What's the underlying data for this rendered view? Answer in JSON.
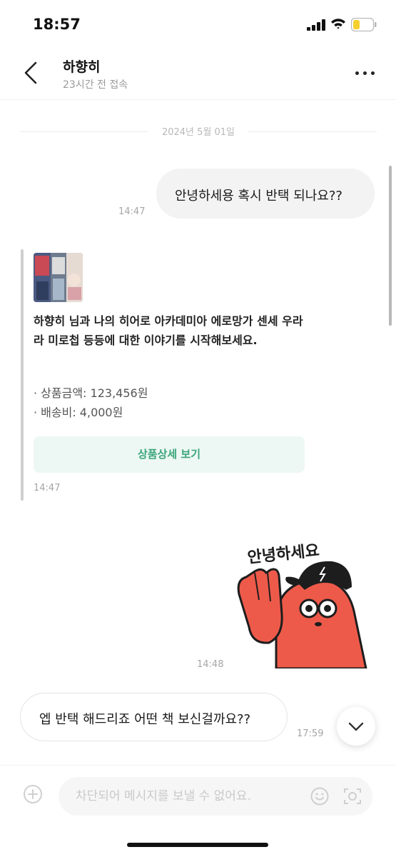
{
  "status_bar": {
    "time": "18:57"
  },
  "header": {
    "name": "하향히",
    "last_seen": "23시간 전 접속"
  },
  "date_divider": "2024년 5월 01일",
  "messages": [
    {
      "text": "안녕하세용 혹시 반택 되나요??",
      "time": "14:47"
    }
  ],
  "product_card": {
    "text": "하향히 님과 나의 히어로 아카데미아 에로망가 센세 우라라 미로첩 등등에 대한 이야기를 시작해보세요.",
    "price": "· 상품금액: 123,456원",
    "shipping": "· 배송비: 4,000원",
    "button_label": "상품상세 보기",
    "time": "14:47"
  },
  "sticker": {
    "text": "안녕하세요",
    "time": "14:48"
  },
  "reply": {
    "text": "엡 반택 해드리죠 어떤 책 보신걸까요??",
    "time": "17:59"
  },
  "composer": {
    "placeholder": "차단되어 메시지를 보낼 수 없어요."
  },
  "colors": {
    "accent_green": "#3aa57a",
    "card_button_bg": "#edf7f3",
    "sticker_red": "#ee5a4a",
    "battery_yellow": "#f6cf2e"
  },
  "icons": [
    "chevron-left-icon",
    "more-icon",
    "chevron-down-icon",
    "plus-circle-icon",
    "smile-icon",
    "camera-icon",
    "signal-icon",
    "wifi-icon",
    "battery-icon"
  ]
}
